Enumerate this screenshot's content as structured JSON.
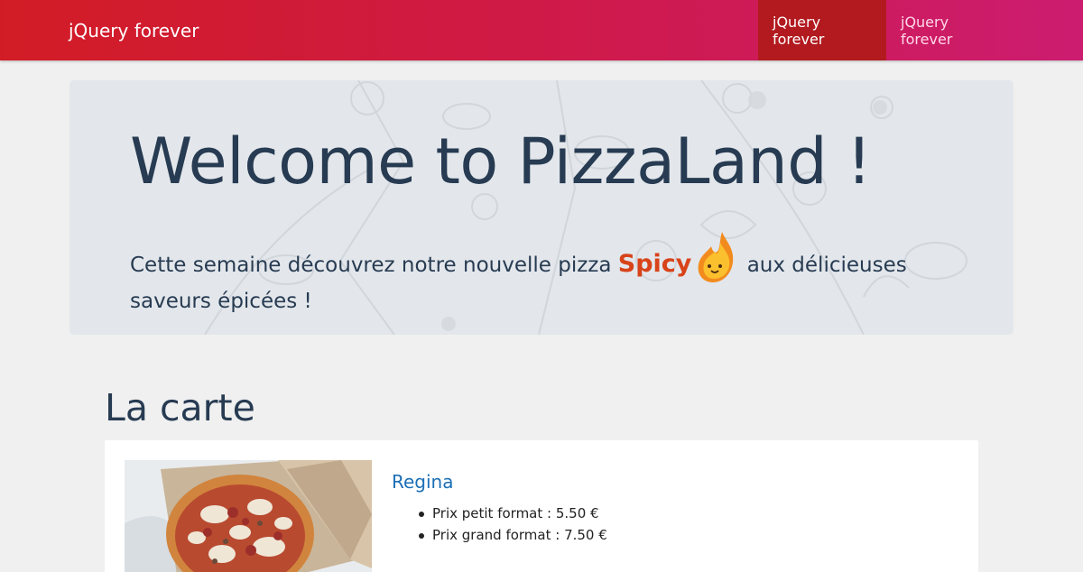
{
  "navbar": {
    "brand": "jQuery forever",
    "links": [
      "jQuery forever",
      "jQuery forever"
    ]
  },
  "hero": {
    "title": "Welcome to PizzaLand !",
    "text_before": "Cette semaine découvrez notre nouvelle pizza ",
    "spicy_word": "Spicy",
    "text_after": " aux délicieuses saveurs épicées !"
  },
  "menu": {
    "title": "La carte",
    "pizzas": [
      {
        "name": "Regina",
        "prices": [
          "Prix petit format : 5.50 €",
          "Prix grand format : 7.50 €"
        ]
      }
    ]
  },
  "colors": {
    "navbar_start": "#d21c25",
    "navbar_end": "#cc1c70",
    "active_link": "#b21a1f",
    "spicy": "#d8431a",
    "link": "#1c6fb5"
  }
}
